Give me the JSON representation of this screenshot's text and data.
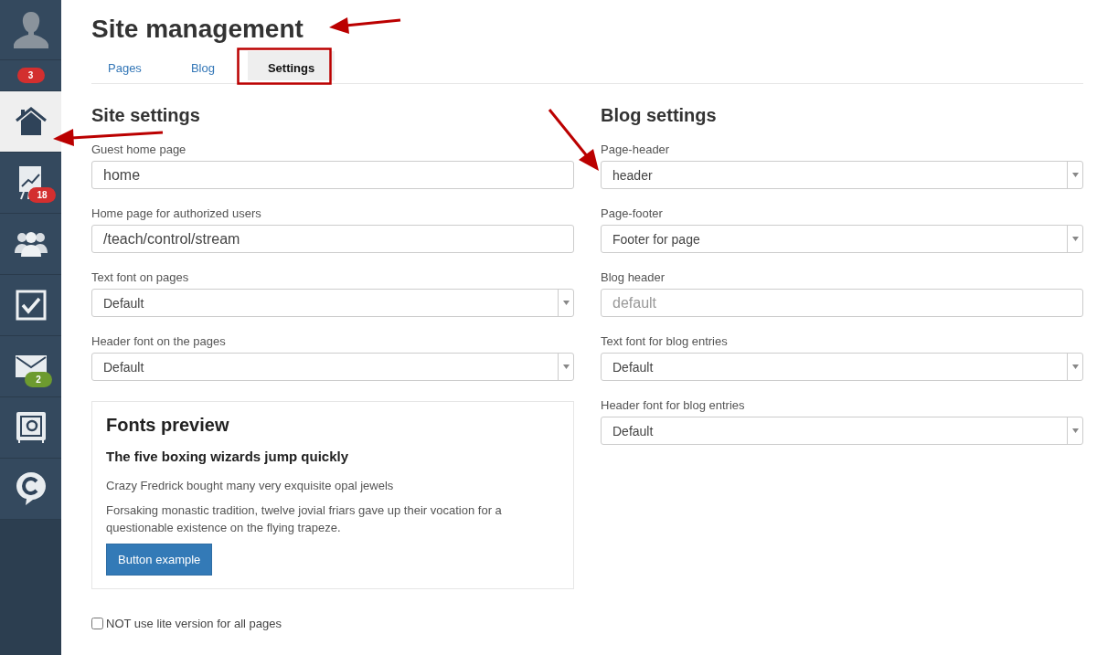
{
  "sidebar": {
    "items": [
      {
        "kind": "avatar",
        "selected": false
      },
      {
        "kind": "counter",
        "selected": false,
        "badge": "3",
        "color": "#d32f2f"
      },
      {
        "kind": "home",
        "selected": true
      },
      {
        "kind": "chart",
        "selected": false,
        "badge": "18",
        "color": "#d32f2f"
      },
      {
        "kind": "people",
        "selected": false
      },
      {
        "kind": "check",
        "selected": false
      },
      {
        "kind": "mail",
        "selected": false,
        "badge": "2",
        "color": "#6d9b2f"
      },
      {
        "kind": "safe",
        "selected": false
      },
      {
        "kind": "chat",
        "selected": false
      }
    ]
  },
  "title": "Site management",
  "tabs": [
    {
      "label": "Pages",
      "selected": false
    },
    {
      "label": "Blog",
      "selected": false
    },
    {
      "label": "Settings",
      "selected": true
    }
  ],
  "columns": [
    {
      "heading": "Site settings",
      "fields": [
        {
          "label": "Guest home page",
          "kind": "text",
          "value": "home"
        },
        {
          "label": "Home page for authorized users",
          "kind": "text",
          "value": "/teach/control/stream"
        },
        {
          "label": "Text font on pages",
          "kind": "select",
          "value": "Default"
        },
        {
          "label": "Header font on the pages",
          "kind": "select",
          "value": "Default"
        }
      ]
    },
    {
      "heading": "Blog settings",
      "fields": [
        {
          "label": "Page-header",
          "kind": "select",
          "value": "header"
        },
        {
          "label": "Page-footer",
          "kind": "select",
          "value": "Footer for page"
        },
        {
          "label": "Blog header",
          "kind": "text",
          "placeholder": "default"
        },
        {
          "label": "Text font for blog entries",
          "kind": "select",
          "value": "Default"
        },
        {
          "label": "Header font for blog entries",
          "kind": "select",
          "value": "Default"
        }
      ]
    }
  ],
  "preview": {
    "title": "Fonts preview",
    "heading": "The five boxing wizards jump quickly",
    "paragraphs": [
      "Crazy Fredrick bought many very exquisite opal jewels",
      "Forsaking monastic tradition, twelve jovial friars gave up their vocation for a questionable existence on the flying trapeze."
    ],
    "button": "Button example"
  },
  "lite_option": {
    "label": "NOT use lite version for all pages",
    "checked": false
  }
}
